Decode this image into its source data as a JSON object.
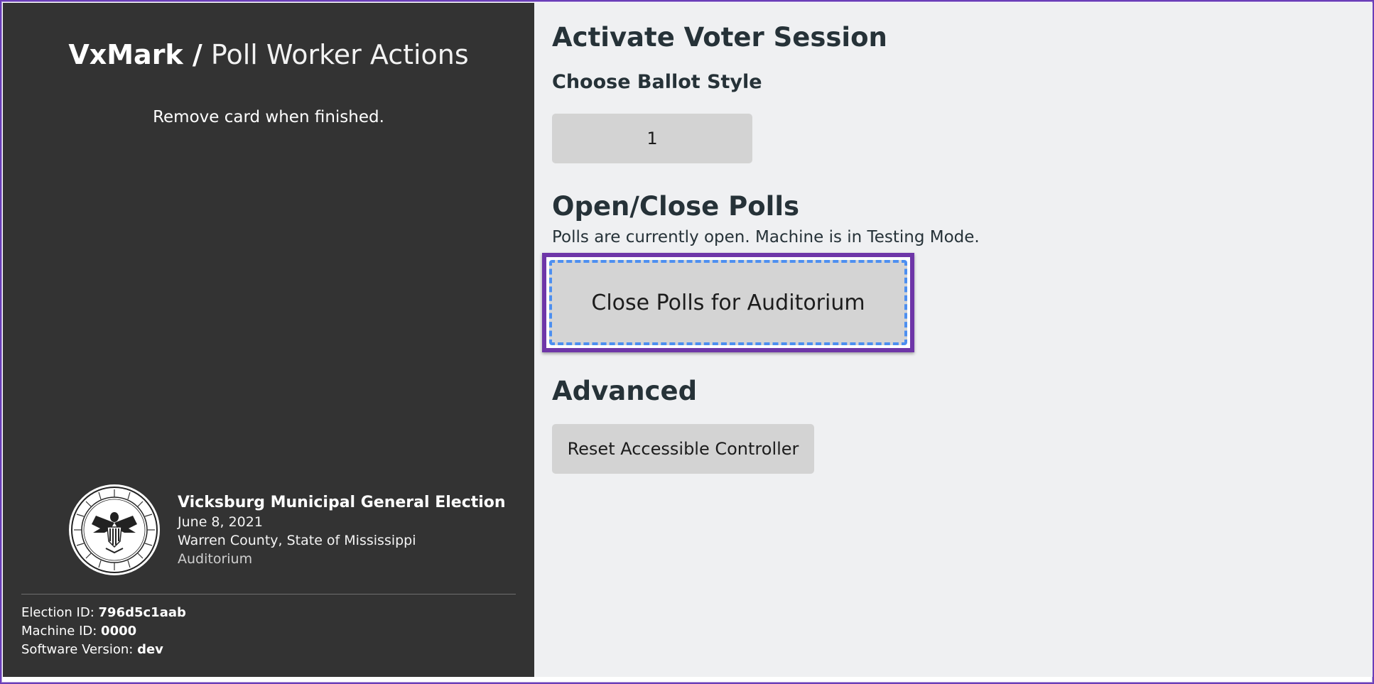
{
  "sidebar": {
    "brand": "VxMark /",
    "page_title": "Poll Worker Actions",
    "instruction": "Remove card when finished.",
    "election": {
      "name": "Vicksburg Municipal General Election",
      "date": "June 8, 2021",
      "location": "Warren County, State of Mississippi",
      "precinct": "Auditorium"
    },
    "meta": {
      "election_id_label": "Election ID:",
      "election_id": "796d5c1aab",
      "machine_id_label": "Machine ID:",
      "machine_id": "0000",
      "software_version_label": "Software Version:",
      "software_version": "dev"
    }
  },
  "main": {
    "voter_session_heading": "Activate Voter Session",
    "ballot_style_heading": "Choose Ballot Style",
    "ballot_styles": [
      "1"
    ],
    "polls_heading": "Open/Close Polls",
    "polls_status": "Polls are currently open. Machine is in Testing Mode.",
    "close_polls_label": "Close Polls for Auditorium",
    "advanced_heading": "Advanced",
    "reset_controller_label": "Reset Accessible Controller"
  },
  "colors": {
    "sidebar_bg": "#333333",
    "main_bg": "#eff0f2",
    "button_bg": "#d3d3d3",
    "focus_outline": "#6e36a8",
    "focus_dash": "#4d8ff0",
    "heading": "#263238"
  },
  "icons": {
    "seal": "state-seal-icon"
  }
}
